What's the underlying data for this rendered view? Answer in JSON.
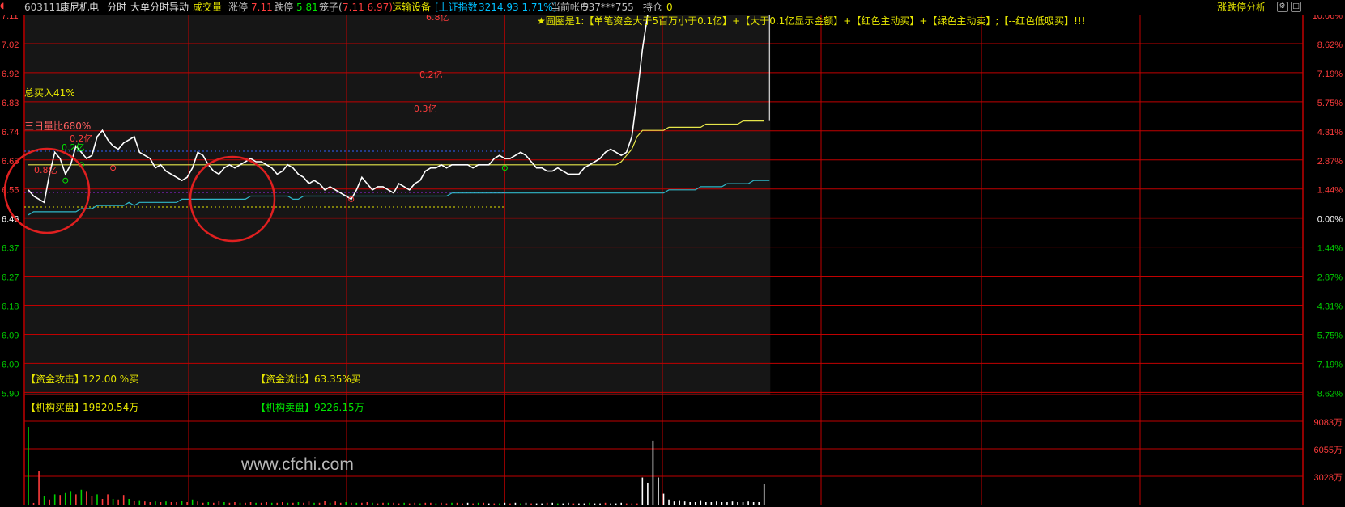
{
  "topbar": {
    "code": "603111",
    "name": "康尼机电",
    "view": "分时",
    "indicator": "大单分时异动",
    "volume_label": "成交量",
    "up_limit_label": "涨停",
    "up_limit_value": "7.11",
    "down_limit_label": "跌停",
    "down_limit_value": "5.81",
    "cage_label": "笼子(",
    "cage_values": "7.11 6.97)",
    "sector": "运输设备",
    "index_text": "[上证指数",
    "index_value": "3214.93 1.71%]",
    "account_label": "当前帐户",
    "account_value": "537***755",
    "position_label": "持仓",
    "position_value": "0",
    "analysis_label": "涨跌停分析",
    "btn_settings": "⚙",
    "btn_close": "□",
    "colors": {
      "code": "#c0c0c0",
      "title": "#e6e6e6",
      "volume_label": "#e6e600",
      "up": "#ff3c3c",
      "down": "#00e600",
      "sector": "#e6e600",
      "index": "#00c0ff",
      "account": "#c0c0c0"
    }
  },
  "annotation": {
    "legend_text": "★圆圈是1:【单笔资金大于5百万小于0.1亿】+【大于0.1亿显示金额】+【红色主动买】+【绿色主动卖】;【--红色低吸买】!!!",
    "total_buy": "总买入41%",
    "volume_ratio": "三日量比680%"
  },
  "stats": {
    "attack_label": "【资金攻击】",
    "attack_value": "122.00 %买",
    "flow_label": "【资金流比】",
    "flow_value": "63.35%买",
    "inst_buy_label": "【机构买盘】",
    "inst_buy_value": "19820.54万",
    "inst_sell_label": "【机构卖盘】",
    "inst_sell_value": "9226.15万"
  },
  "watermark": "www.cfchi.com",
  "chart_data": {
    "type": "line",
    "title": "",
    "prev_close": 6.46,
    "y_ticks_left": [
      "7.11",
      "7.02",
      "6.92",
      "6.83",
      "6.74",
      "6.65",
      "6.55",
      "6.46",
      "6.37",
      "6.27",
      "6.18",
      "6.09",
      "6.00",
      "5.90"
    ],
    "y_ticks_right": [
      "10.06%",
      "8.62%",
      "7.19%",
      "5.75%",
      "4.31%",
      "2.87%",
      "1.44%",
      "0.00%",
      "1.44%",
      "2.87%",
      "4.31%",
      "5.75%",
      "7.19%",
      "8.62%"
    ],
    "ylim": [
      5.81,
      7.11
    ],
    "volume_ticks": [
      "9083万",
      "6055万",
      "3028万"
    ],
    "volume_max": 12110,
    "session_minutes": 240,
    "price": [
      6.55,
      6.53,
      6.52,
      6.51,
      6.6,
      6.67,
      6.65,
      6.6,
      6.63,
      6.69,
      6.67,
      6.65,
      6.66,
      6.72,
      6.74,
      6.71,
      6.69,
      6.68,
      6.7,
      6.71,
      6.72,
      6.67,
      6.66,
      6.65,
      6.62,
      6.63,
      6.61,
      6.6,
      6.59,
      6.58,
      6.59,
      6.62,
      6.67,
      6.66,
      6.63,
      6.61,
      6.6,
      6.62,
      6.63,
      6.62,
      6.63,
      6.64,
      6.65,
      6.64,
      6.64,
      6.63,
      6.62,
      6.6,
      6.61,
      6.63,
      6.62,
      6.6,
      6.59,
      6.57,
      6.58,
      6.57,
      6.55,
      6.56,
      6.55,
      6.54,
      6.53,
      6.52,
      6.55,
      6.59,
      6.57,
      6.55,
      6.56,
      6.56,
      6.55,
      6.54,
      6.57,
      6.56,
      6.55,
      6.57,
      6.58,
      6.61,
      6.62,
      6.62,
      6.63,
      6.62,
      6.63,
      6.63,
      6.63,
      6.63,
      6.62,
      6.63,
      6.63,
      6.63,
      6.65,
      6.66,
      6.65,
      6.65,
      6.66,
      6.67,
      6.66,
      6.64,
      6.62,
      6.62,
      6.61,
      6.61,
      6.62,
      6.61,
      6.6,
      6.6,
      6.6,
      6.62,
      6.63,
      6.64,
      6.65,
      6.67,
      6.68,
      6.67,
      6.66,
      6.67,
      6.72,
      6.85,
      7.0,
      7.11,
      7.11,
      7.11,
      7.11,
      7.11,
      7.11,
      7.11,
      7.11,
      7.11,
      7.11,
      7.11,
      7.11,
      7.11,
      7.11,
      7.11,
      7.11,
      7.11,
      7.11,
      7.11,
      7.11,
      7.11,
      7.11,
      7.11,
      7.11
    ],
    "avg_price": [
      6.63,
      6.63,
      6.63,
      6.63,
      6.63,
      6.63,
      6.63,
      6.63,
      6.63,
      6.63,
      6.63,
      6.63,
      6.63,
      6.63,
      6.63,
      6.63,
      6.63,
      6.63,
      6.63,
      6.63,
      6.63,
      6.63,
      6.63,
      6.63,
      6.63,
      6.63,
      6.63,
      6.63,
      6.63,
      6.63,
      6.63,
      6.63,
      6.63,
      6.63,
      6.63,
      6.63,
      6.63,
      6.63,
      6.63,
      6.63,
      6.63,
      6.63,
      6.63,
      6.63,
      6.63,
      6.63,
      6.63,
      6.63,
      6.63,
      6.63,
      6.63,
      6.63,
      6.63,
      6.63,
      6.63,
      6.63,
      6.63,
      6.63,
      6.63,
      6.63,
      6.63,
      6.63,
      6.63,
      6.63,
      6.63,
      6.63,
      6.63,
      6.63,
      6.63,
      6.63,
      6.63,
      6.63,
      6.63,
      6.63,
      6.63,
      6.63,
      6.63,
      6.63,
      6.63,
      6.63,
      6.63,
      6.63,
      6.63,
      6.63,
      6.63,
      6.63,
      6.63,
      6.63,
      6.63,
      6.63,
      6.63,
      6.63,
      6.63,
      6.63,
      6.63,
      6.63,
      6.63,
      6.63,
      6.63,
      6.63,
      6.63,
      6.63,
      6.63,
      6.63,
      6.63,
      6.63,
      6.63,
      6.63,
      6.63,
      6.63,
      6.63,
      6.63,
      6.64,
      6.66,
      6.68,
      6.72,
      6.74,
      6.74,
      6.74,
      6.74,
      6.74,
      6.75,
      6.75,
      6.75,
      6.75,
      6.75,
      6.75,
      6.75,
      6.76,
      6.76,
      6.76,
      6.76,
      6.76,
      6.76,
      6.76,
      6.77,
      6.77,
      6.77,
      6.77,
      6.77
    ],
    "cyan_line": [
      6.47,
      6.48,
      6.48,
      6.48,
      6.48,
      6.48,
      6.48,
      6.48,
      6.48,
      6.48,
      6.49,
      6.49,
      6.49,
      6.5,
      6.5,
      6.5,
      6.5,
      6.5,
      6.5,
      6.51,
      6.5,
      6.51,
      6.51,
      6.51,
      6.51,
      6.51,
      6.51,
      6.51,
      6.51,
      6.52,
      6.52,
      6.52,
      6.52,
      6.52,
      6.52,
      6.52,
      6.52,
      6.52,
      6.52,
      6.52,
      6.52,
      6.52,
      6.53,
      6.53,
      6.53,
      6.53,
      6.53,
      6.53,
      6.53,
      6.53,
      6.52,
      6.52,
      6.53,
      6.53,
      6.53,
      6.53,
      6.53,
      6.53,
      6.53,
      6.53,
      6.53,
      6.53,
      6.53,
      6.53,
      6.53,
      6.53,
      6.53,
      6.53,
      6.53,
      6.53,
      6.53,
      6.53,
      6.53,
      6.53,
      6.53,
      6.53,
      6.53,
      6.53,
      6.53,
      6.53,
      6.54,
      6.54,
      6.54,
      6.54,
      6.54,
      6.54,
      6.54,
      6.54,
      6.54,
      6.54,
      6.54,
      6.54,
      6.54,
      6.54,
      6.54,
      6.54,
      6.54,
      6.54,
      6.54,
      6.54,
      6.54,
      6.54,
      6.54,
      6.54,
      6.54,
      6.54,
      6.54,
      6.54,
      6.54,
      6.54,
      6.54,
      6.54,
      6.54,
      6.54,
      6.54,
      6.54,
      6.54,
      6.54,
      6.54,
      6.54,
      6.54,
      6.55,
      6.55,
      6.55,
      6.55,
      6.55,
      6.55,
      6.56,
      6.56,
      6.56,
      6.56,
      6.56,
      6.57,
      6.57,
      6.57,
      6.57,
      6.57,
      6.58,
      6.58,
      6.58,
      6.58
    ],
    "volume": [
      12110,
      380,
      5300,
      1400,
      900,
      1700,
      1600,
      1900,
      2200,
      1700,
      2400,
      2200,
      1400,
      1700,
      1000,
      1700,
      1000,
      900,
      1600,
      1000,
      700,
      800,
      600,
      500,
      600,
      500,
      600,
      500,
      500,
      700,
      500,
      900,
      600,
      400,
      500,
      400,
      700,
      500,
      400,
      500,
      400,
      400,
      500,
      400,
      400,
      500,
      400,
      400,
      500,
      400,
      400,
      500,
      400,
      600,
      400,
      400,
      700,
      400,
      600,
      400,
      500,
      400,
      400,
      400,
      500,
      400,
      300,
      400,
      400,
      400,
      300,
      400,
      300,
      400,
      300,
      400,
      400,
      300,
      400,
      300,
      400,
      400,
      300,
      400,
      300,
      400,
      400,
      300,
      300,
      300,
      400,
      300,
      400,
      300,
      400,
      300,
      300,
      300,
      400,
      400,
      300,
      300,
      400,
      300,
      300,
      300,
      400,
      300,
      300,
      400,
      300,
      300,
      400,
      300,
      300,
      300,
      4300,
      3500,
      10000,
      4300,
      1800,
      900,
      600,
      800,
      600,
      500,
      500,
      800,
      500,
      500,
      600,
      500,
      500,
      600,
      500,
      500,
      600,
      500,
      500,
      3300
    ],
    "volume_colors": [
      "g",
      "r",
      "r",
      "g",
      "r",
      "g",
      "r",
      "g",
      "g",
      "r",
      "g",
      "r",
      "r",
      "g",
      "r",
      "r",
      "g",
      "r",
      "r",
      "g",
      "r",
      "g",
      "r",
      "r",
      "g",
      "r",
      "g",
      "r",
      "r",
      "g",
      "r",
      "g",
      "r",
      "r",
      "g",
      "r",
      "r",
      "g",
      "r",
      "r",
      "g",
      "r",
      "r",
      "g",
      "r",
      "r",
      "g",
      "r",
      "r",
      "g",
      "r",
      "g",
      "r",
      "r",
      "g",
      "r",
      "r",
      "g",
      "r",
      "r",
      "g",
      "r",
      "g",
      "r",
      "r",
      "g",
      "r",
      "r",
      "g",
      "r",
      "r",
      "g",
      "r",
      "r",
      "g",
      "r",
      "r",
      "g",
      "r",
      "r",
      "g",
      "r",
      "r",
      "w",
      "r",
      "g",
      "r",
      "w",
      "r",
      "g",
      "w",
      "r",
      "w",
      "g",
      "w",
      "r",
      "w",
      "w",
      "r",
      "w",
      "g",
      "w",
      "w",
      "r",
      "w",
      "w",
      "g",
      "w",
      "w",
      "r",
      "w",
      "w",
      "w",
      "r",
      "r",
      "r",
      "w",
      "w",
      "w",
      "w",
      "w",
      "w",
      "w",
      "w",
      "w",
      "w",
      "w",
      "w",
      "w",
      "w",
      "w",
      "w",
      "w",
      "w",
      "w",
      "w",
      "w",
      "w",
      "w",
      "w",
      "w"
    ],
    "flow_labels": [
      {
        "text": "0.8亿",
        "i": 4
      },
      {
        "text": "0.2亿",
        "i": 7
      },
      {
        "text": "0.2亿",
        "i": 10
      },
      {
        "text": "6.8亿",
        "i": 113
      },
      {
        "text": "0.2亿",
        "i": 114
      },
      {
        "text": "0.3亿",
        "i": 113
      }
    ],
    "circle_marks": [
      {
        "i": 7,
        "price": 6.58,
        "color": "g"
      },
      {
        "i": 10,
        "price": 6.63,
        "color": "g"
      },
      {
        "i": 16,
        "price": 6.62,
        "color": "r"
      },
      {
        "i": 61,
        "price": 6.52,
        "color": "r"
      },
      {
        "i": 90,
        "price": 6.62,
        "color": "g"
      }
    ],
    "colors": {
      "price": "#ffffff",
      "avg": "#e6e64a",
      "cyan": "#2fb7c8",
      "grid": "#c00000",
      "axis_red": "#ff3c3c",
      "axis_green": "#00d000",
      "volume_red": "#ff3c3c",
      "volume_green": "#00d000",
      "volume_white": "#ffffff",
      "highlight": "#e02020"
    }
  }
}
